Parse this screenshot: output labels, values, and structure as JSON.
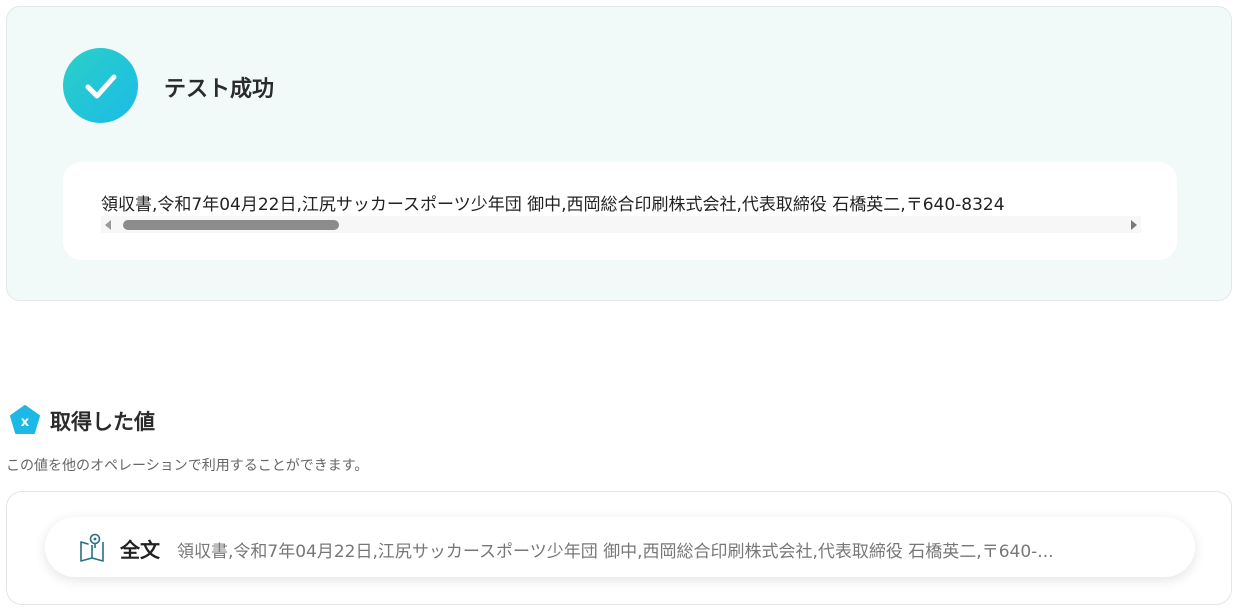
{
  "success": {
    "title": "テスト成功",
    "output_text": "領収書,令和7年04月22日,江尻サッカースポーツ少年団 御中,西岡総合印刷株式会社,代表取締役 石橋英二,〒640-8324"
  },
  "acquired": {
    "title": "取得した値",
    "description": "この値を他のオペレーションで利用することができます。",
    "items": [
      {
        "label": "全文",
        "value": "領収書,令和7年04月22日,江尻サッカースポーツ少年団 御中,西岡総合印刷株式会社,代表取締役 石橋英二,〒640-..."
      }
    ]
  },
  "colors": {
    "accent_start": "#2ad0c6",
    "accent_end": "#1bbbe8",
    "card_bg": "#f1f9f9",
    "icon_pentagon": "#1cb9e6"
  },
  "icons": {
    "success": "check-icon",
    "acquired": "variable-pentagon-icon",
    "item": "book-icon"
  }
}
